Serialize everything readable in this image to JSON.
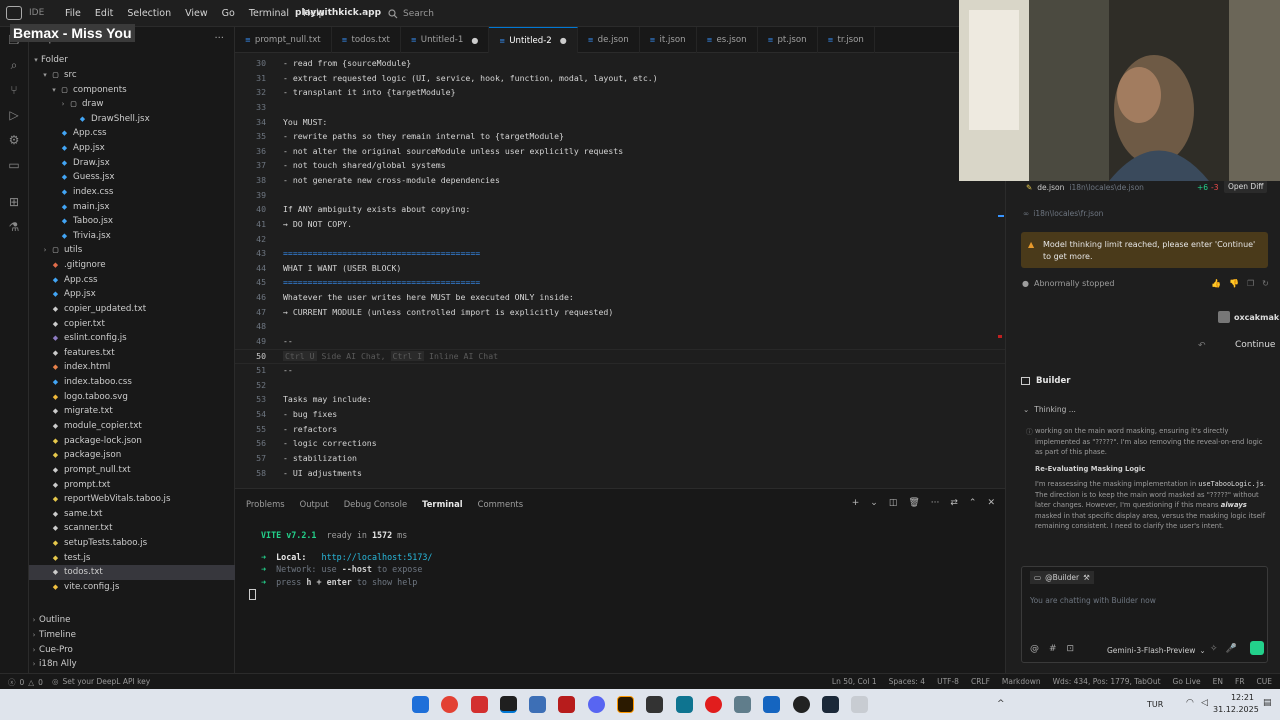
{
  "titlebar": {
    "app_name": "IDE",
    "menu": [
      "File",
      "Edit",
      "Selection",
      "View",
      "Go",
      "Terminal",
      "Help"
    ],
    "workspace": "playwithkick.app",
    "search_placeholder": "Search"
  },
  "overlay_badge": "Bemax - Miss You",
  "sidebar": {
    "title": "Explorer",
    "root": "Folder",
    "items": [
      {
        "label": "src",
        "depth": 1,
        "kind": "folder-open",
        "color": "#cccccc"
      },
      {
        "label": "components",
        "depth": 2,
        "kind": "folder-open",
        "color": "#cccccc"
      },
      {
        "label": "draw",
        "depth": 3,
        "kind": "folder",
        "color": "#cccccc"
      },
      {
        "label": "DrawShell.jsx",
        "depth": 4,
        "kind": "file",
        "color": "#42a5f5"
      },
      {
        "label": "App.css",
        "depth": 2,
        "kind": "file",
        "color": "#42a5f5"
      },
      {
        "label": "App.jsx",
        "depth": 2,
        "kind": "file",
        "color": "#42a5f5"
      },
      {
        "label": "Draw.jsx",
        "depth": 2,
        "kind": "file",
        "color": "#42a5f5"
      },
      {
        "label": "Guess.jsx",
        "depth": 2,
        "kind": "file",
        "color": "#42a5f5"
      },
      {
        "label": "index.css",
        "depth": 2,
        "kind": "file",
        "color": "#42a5f5"
      },
      {
        "label": "main.jsx",
        "depth": 2,
        "kind": "file",
        "color": "#42a5f5"
      },
      {
        "label": "Taboo.jsx",
        "depth": 2,
        "kind": "file",
        "color": "#42a5f5"
      },
      {
        "label": "Trivia.jsx",
        "depth": 2,
        "kind": "file",
        "color": "#42a5f5"
      },
      {
        "label": "utils",
        "depth": 1,
        "kind": "folder",
        "color": "#cccccc"
      },
      {
        "label": ".gitignore",
        "depth": 1,
        "kind": "file",
        "color": "#e06c4a"
      },
      {
        "label": "App.css",
        "depth": 1,
        "kind": "file",
        "color": "#42a5f5"
      },
      {
        "label": "App.jsx",
        "depth": 1,
        "kind": "file",
        "color": "#42a5f5"
      },
      {
        "label": "copier_updated.txt",
        "depth": 1,
        "kind": "file",
        "color": "#cccccc"
      },
      {
        "label": "copier.txt",
        "depth": 1,
        "kind": "file",
        "color": "#cccccc"
      },
      {
        "label": "eslint.config.js",
        "depth": 1,
        "kind": "file",
        "color": "#8e7cc3"
      },
      {
        "label": "features.txt",
        "depth": 1,
        "kind": "file",
        "color": "#cccccc"
      },
      {
        "label": "index.html",
        "depth": 1,
        "kind": "file",
        "color": "#e8824b"
      },
      {
        "label": "index.taboo.css",
        "depth": 1,
        "kind": "file",
        "color": "#42a5f5"
      },
      {
        "label": "logo.taboo.svg",
        "depth": 1,
        "kind": "file",
        "color": "#f0b93a"
      },
      {
        "label": "migrate.txt",
        "depth": 1,
        "kind": "file",
        "color": "#cccccc"
      },
      {
        "label": "module_copier.txt",
        "depth": 1,
        "kind": "file",
        "color": "#cccccc"
      },
      {
        "label": "package-lock.json",
        "depth": 1,
        "kind": "file",
        "color": "#e6c84b"
      },
      {
        "label": "package.json",
        "depth": 1,
        "kind": "file",
        "color": "#e6c84b"
      },
      {
        "label": "prompt_null.txt",
        "depth": 1,
        "kind": "file",
        "color": "#cccccc"
      },
      {
        "label": "prompt.txt",
        "depth": 1,
        "kind": "file",
        "color": "#cccccc"
      },
      {
        "label": "reportWebVitals.taboo.js",
        "depth": 1,
        "kind": "file",
        "color": "#e6c84b"
      },
      {
        "label": "same.txt",
        "depth": 1,
        "kind": "file",
        "color": "#cccccc"
      },
      {
        "label": "scanner.txt",
        "depth": 1,
        "kind": "file",
        "color": "#cccccc"
      },
      {
        "label": "setupTests.taboo.js",
        "depth": 1,
        "kind": "file",
        "color": "#e6c84b"
      },
      {
        "label": "test.js",
        "depth": 1,
        "kind": "file",
        "color": "#e6c84b"
      },
      {
        "label": "todos.txt",
        "depth": 1,
        "kind": "file",
        "color": "#cccccc",
        "selected": true
      },
      {
        "label": "vite.config.js",
        "depth": 1,
        "kind": "file",
        "color": "#f0c040"
      }
    ],
    "sections": [
      "Outline",
      "Timeline",
      "Cue-Pro",
      "i18n Ally"
    ]
  },
  "tabs": [
    {
      "label": "prompt_null.txt",
      "active": false
    },
    {
      "label": "todos.txt",
      "active": false
    },
    {
      "label": "Untitled-1",
      "active": false,
      "dirty": true
    },
    {
      "label": "Untitled-2",
      "active": true,
      "dirty": true
    },
    {
      "label": "de.json",
      "active": false
    },
    {
      "label": "it.json",
      "active": false
    },
    {
      "label": "es.json",
      "active": false
    },
    {
      "label": "pt.json",
      "active": false
    },
    {
      "label": "tr.json",
      "active": false
    }
  ],
  "editor": {
    "current_line": 50,
    "lines": [
      {
        "n": 30,
        "text": "- read from {sourceModule}"
      },
      {
        "n": 31,
        "text": "- extract requested logic (UI, service, hook, function, modal, layout, etc.)"
      },
      {
        "n": 32,
        "text": "- transplant it into {targetModule}"
      },
      {
        "n": 33,
        "text": ""
      },
      {
        "n": 34,
        "text": "You MUST:"
      },
      {
        "n": 35,
        "text": "- rewrite paths so they remain internal to {targetModule}"
      },
      {
        "n": 36,
        "text": "- not alter the original sourceModule unless user explicitly requests"
      },
      {
        "n": 37,
        "text": "- not touch shared/global systems"
      },
      {
        "n": 38,
        "text": "- not generate new cross-module dependencies"
      },
      {
        "n": 39,
        "text": ""
      },
      {
        "n": 40,
        "text": "If ANY ambiguity exists about copying:"
      },
      {
        "n": 41,
        "text": "→ DO NOT COPY."
      },
      {
        "n": 42,
        "text": ""
      },
      {
        "n": 43,
        "text": "========================================",
        "sep": true
      },
      {
        "n": 44,
        "text": "WHAT I WANT (USER BLOCK)"
      },
      {
        "n": 45,
        "text": "========================================",
        "sep": true
      },
      {
        "n": 46,
        "text": "Whatever the user writes here MUST be executed ONLY inside:"
      },
      {
        "n": 47,
        "text": "→ CURRENT MODULE (unless controlled import is explicitly requested)"
      },
      {
        "n": 48,
        "text": ""
      },
      {
        "n": 49,
        "text": "--"
      },
      {
        "n": 50,
        "text": ""
      },
      {
        "n": 51,
        "text": "--"
      },
      {
        "n": 52,
        "text": ""
      },
      {
        "n": 53,
        "text": "Tasks may include:"
      },
      {
        "n": 54,
        "text": "- bug fixes"
      },
      {
        "n": 55,
        "text": "- refactors"
      },
      {
        "n": 56,
        "text": "- logic corrections"
      },
      {
        "n": 57,
        "text": "- stabilization"
      },
      {
        "n": 58,
        "text": "- UI adjustments"
      }
    ],
    "ghost_hint": {
      "k1": "Ctrl U",
      "t1": " Side AI Chat, ",
      "k2": "Ctrl I",
      "t2": " Inline AI Chat"
    }
  },
  "panel": {
    "tabs": [
      "Problems",
      "Output",
      "Debug Console",
      "Terminal",
      "Comments"
    ],
    "active_tab": "Terminal",
    "terminal": {
      "vite": "VITE v7.2.1",
      "ready": "ready in",
      "ms_value": "1572",
      "ms_unit": "ms",
      "local_label": "Local:",
      "local_url": "http://localhost:5173/",
      "network_label": "Network:",
      "network_text": "use",
      "network_flag": "--host",
      "network_tail": "to expose",
      "help_pre": "press",
      "help_key": "h + enter",
      "help_tail": "to show help"
    }
  },
  "chat": {
    "file_change": {
      "name": "de.json",
      "path": "i18n\\locales\\de.json",
      "added": "+6",
      "removed": "-3",
      "open_diff": "Open Diff"
    },
    "file_ref": "i18n\\locales\\fr.json",
    "warning": "Model thinking limit reached, please enter 'Continue' to get more.",
    "status": "Abnormally stopped",
    "user": "oxcakmak",
    "continue_label": "Continue",
    "builder_title": "Builder",
    "thinking_label": "Thinking ...",
    "thinking_text_1": "working on the main word masking, ensuring it's directly implemented as \"?????\". I'm also removing the reveal-on-end logic as part of this phase.",
    "thinking_heading": "Re-Evaluating Masking Logic",
    "thinking_text_2a": "I'm reassessing the masking implementation in",
    "thinking_code": "useTabooLogic.js",
    "thinking_text_2b": ". The direction is to keep the main word masked as \"?????\" without later changes. However, I'm questioning if this means",
    "thinking_em": "always",
    "thinking_text_2c": "masked in that specific display area, versus the masking logic itself remaining consistent. I need to clarify the user's intent.",
    "agent_tag": "@Builder",
    "input_placeholder": "You are chatting with Builder now",
    "model": "Gemini-3-Flash-Preview"
  },
  "statusbar": {
    "left": "Set your DeepL API key",
    "errors": "0",
    "warnings": "0",
    "right": [
      "Ln 50, Col 1",
      "Spaces: 4",
      "UTF-8",
      "CRLF",
      "Markdown",
      "Wds: 434, Pos: 1779, TabOut",
      "Go Live",
      "EN",
      "FR",
      "CUE"
    ]
  },
  "taskbar": {
    "lang": "TUR",
    "time": "12:21",
    "date": "31.12.2025"
  },
  "colors": {
    "accent": "#0078d4",
    "link": "#3794ff",
    "warning_bg": "#4a3a1a",
    "continue_green": "#23d18b"
  }
}
